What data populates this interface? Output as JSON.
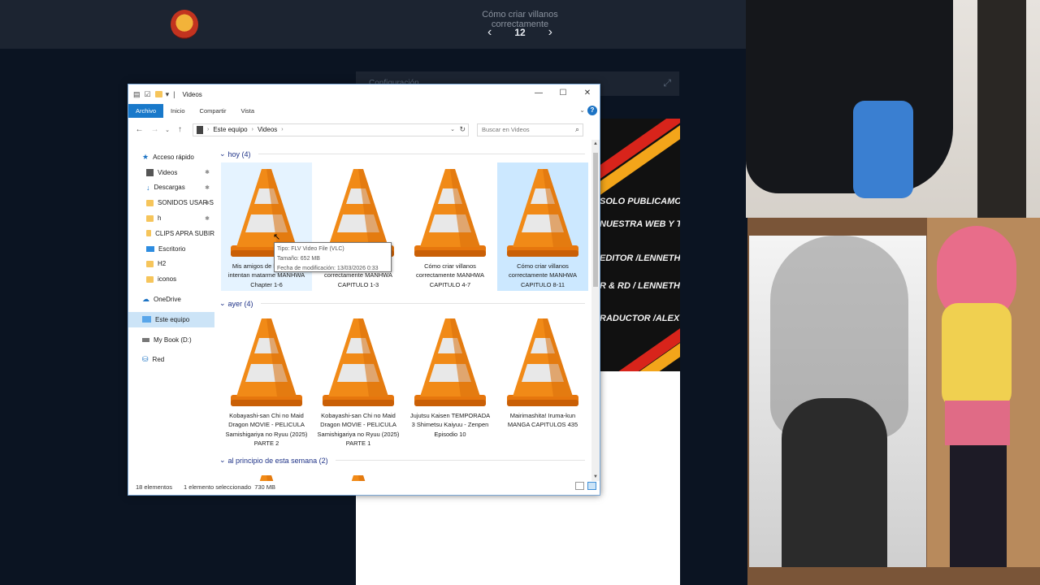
{
  "site": {
    "title": "Cómo criar villanos correctamente",
    "page_number": "12",
    "prev_icon": "‹",
    "next_icon": "›",
    "config_label": "Configuración"
  },
  "banner": {
    "lines": [
      "SOLO PUBLICAMOS",
      "NUESTRA WEB Y TMO",
      "EDITOR /LENNETH",
      "R & RD / LENNETH",
      "RADUCTOR /ALEX"
    ]
  },
  "explorer": {
    "title": "Videos",
    "ribbon_tabs": [
      "Archivo",
      "Inicio",
      "Compartir",
      "Vista"
    ],
    "address": [
      "Este equipo",
      "Videos"
    ],
    "search_placeholder": "Buscar en Videos",
    "sidebar": [
      {
        "label": "Acceso rápido",
        "icon": "star-icon"
      },
      {
        "label": "Videos",
        "icon": "video-folder-icon",
        "pinned": true
      },
      {
        "label": "Descargas",
        "icon": "download-icon",
        "pinned": true
      },
      {
        "label": "SONIDOS USAR S",
        "icon": "folder-icon",
        "pinned": true
      },
      {
        "label": "h",
        "icon": "folder-icon",
        "pinned": true
      },
      {
        "label": "CLIPS APRA SUBIR",
        "icon": "folder-icon"
      },
      {
        "label": "Escritorio",
        "icon": "desktop-icon"
      },
      {
        "label": "H2",
        "icon": "folder-icon"
      },
      {
        "label": "iconos",
        "icon": "folder-icon"
      },
      {
        "label": "OneDrive",
        "icon": "cloud-icon"
      },
      {
        "label": "Este equipo",
        "icon": "pc-icon",
        "selected": true
      },
      {
        "label": "My Book (D:)",
        "icon": "drive-icon"
      },
      {
        "label": "Red",
        "icon": "network-icon"
      }
    ],
    "groups": [
      {
        "label": "hoy (4)",
        "files": [
          {
            "name": "Mis amigos de la infancia intentan matarme MANHWA Chapter 1-6",
            "state": "hover"
          },
          {
            "name": "Cómo criar villanos correctamente MANHWA CAPITULO 1-3",
            "state": ""
          },
          {
            "name": "Cómo criar villanos correctamente MANHWA CAPITULO 4-7",
            "state": ""
          },
          {
            "name": "Cómo criar villanos correctamente MANHWA CAPITULO 8-11",
            "state": "selected"
          }
        ]
      },
      {
        "label": "ayer (4)",
        "files": [
          {
            "name": "Kobayashi-san Chi no Maid Dragon MOVIE - PELICULA Samishigariya no Ryuu (2025) PARTE 2",
            "state": ""
          },
          {
            "name": "Kobayashi-san Chi no Maid Dragon MOVIE - PELICULA Samishigariya no Ryuu (2025) PARTE 1",
            "state": ""
          },
          {
            "name": "Jujutsu Kaisen TEMPORADA 3 Shimetsu Kaiyuu - Zenpen Episodio 10",
            "state": ""
          },
          {
            "name": "Mairimashita! Iruma-kun MANGA CAPITULOS 435",
            "state": ""
          }
        ]
      },
      {
        "label": "al principio de esta semana (2)",
        "files": [
          {
            "name": "",
            "state": ""
          },
          {
            "name": "",
            "state": ""
          }
        ]
      }
    ],
    "tooltip": {
      "type": "Tipo: FLV Video File (VLC)",
      "size": "Tamaño: 652 MB",
      "modified": "Fecha de modificación: 13/03/2026 0:33"
    },
    "status": {
      "count": "18 elementos",
      "selection": "1 elemento seleccionado",
      "size": "730 MB"
    }
  }
}
